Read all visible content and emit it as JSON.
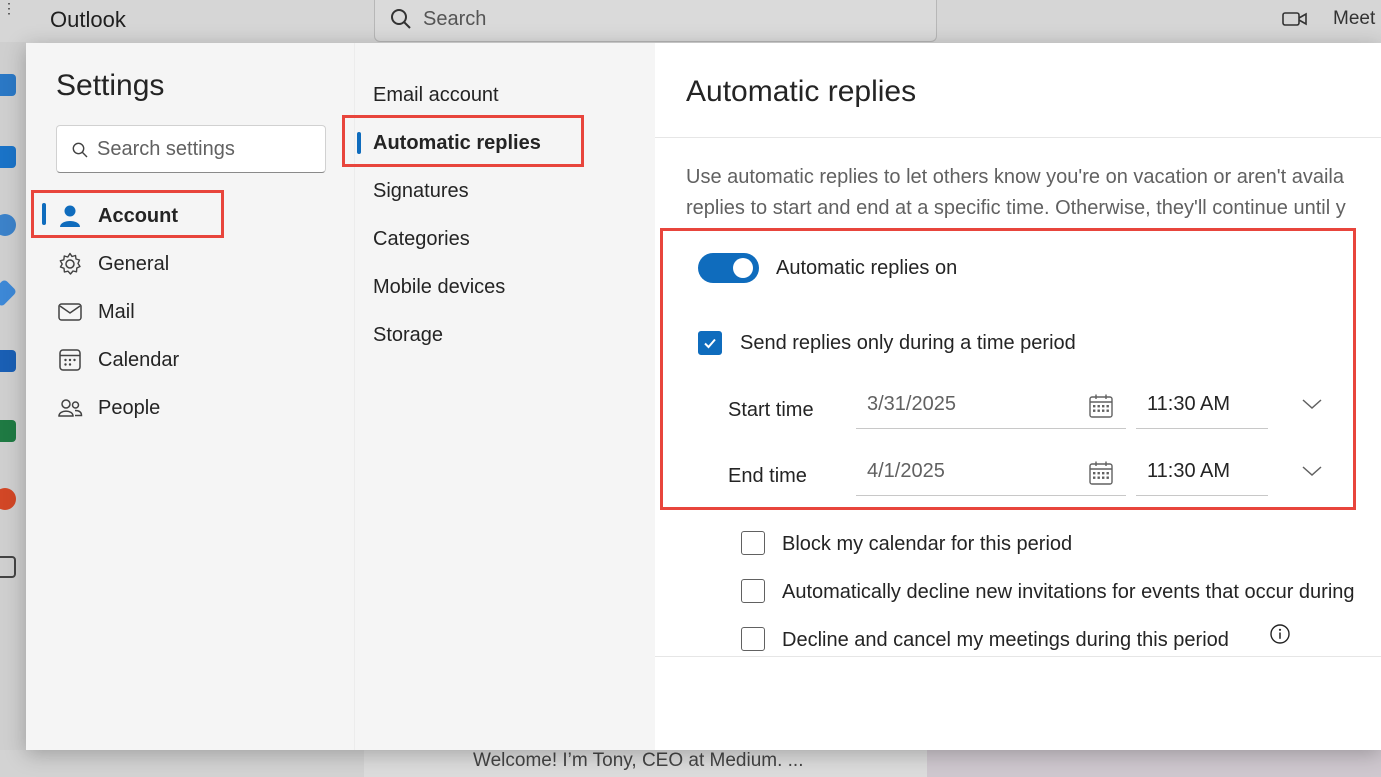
{
  "app": {
    "title": "Outlook",
    "search_label": "Search",
    "meet_label": "Meet"
  },
  "background": {
    "preview_text": "Welcome! I’m Tony, CEO at Medium. ..."
  },
  "settings": {
    "title": "Settings",
    "search_placeholder": "Search settings",
    "nav": [
      {
        "label": "Account",
        "icon": "person-icon",
        "selected": true
      },
      {
        "label": "General",
        "icon": "gear-icon",
        "selected": false
      },
      {
        "label": "Mail",
        "icon": "mail-icon",
        "selected": false
      },
      {
        "label": "Calendar",
        "icon": "calendar-icon",
        "selected": false
      },
      {
        "label": "People",
        "icon": "people-icon",
        "selected": false
      }
    ],
    "subnav": [
      {
        "label": "Email account",
        "selected": false
      },
      {
        "label": "Automatic replies",
        "selected": true
      },
      {
        "label": "Signatures",
        "selected": false
      },
      {
        "label": "Categories",
        "selected": false
      },
      {
        "label": "Mobile devices",
        "selected": false
      },
      {
        "label": "Storage",
        "selected": false
      }
    ]
  },
  "content": {
    "title": "Automatic replies",
    "description_line1": "Use automatic replies to let others know you're on vacation or aren't availa",
    "description_line2": "replies to start and end at a specific time. Otherwise, they'll continue until y",
    "toggle_label": "Automatic replies on",
    "toggle_on": true,
    "time_period_label": "Send replies only during a time period",
    "time_period_checked": true,
    "start_label": "Start time",
    "start_date": "3/31/2025",
    "start_time": "11:30 AM",
    "end_label": "End time",
    "end_date": "4/1/2025",
    "end_time": "11:30 AM",
    "options": [
      {
        "label": "Block my calendar for this period",
        "checked": false
      },
      {
        "label": "Automatically decline new invitations for events that occur during",
        "checked": false
      },
      {
        "label": "Decline and cancel my meetings during this period",
        "checked": false
      }
    ]
  },
  "colors": {
    "accent": "#0f6cbd",
    "highlight": "#e8453c",
    "nav_bg": "#f5f5f5"
  }
}
